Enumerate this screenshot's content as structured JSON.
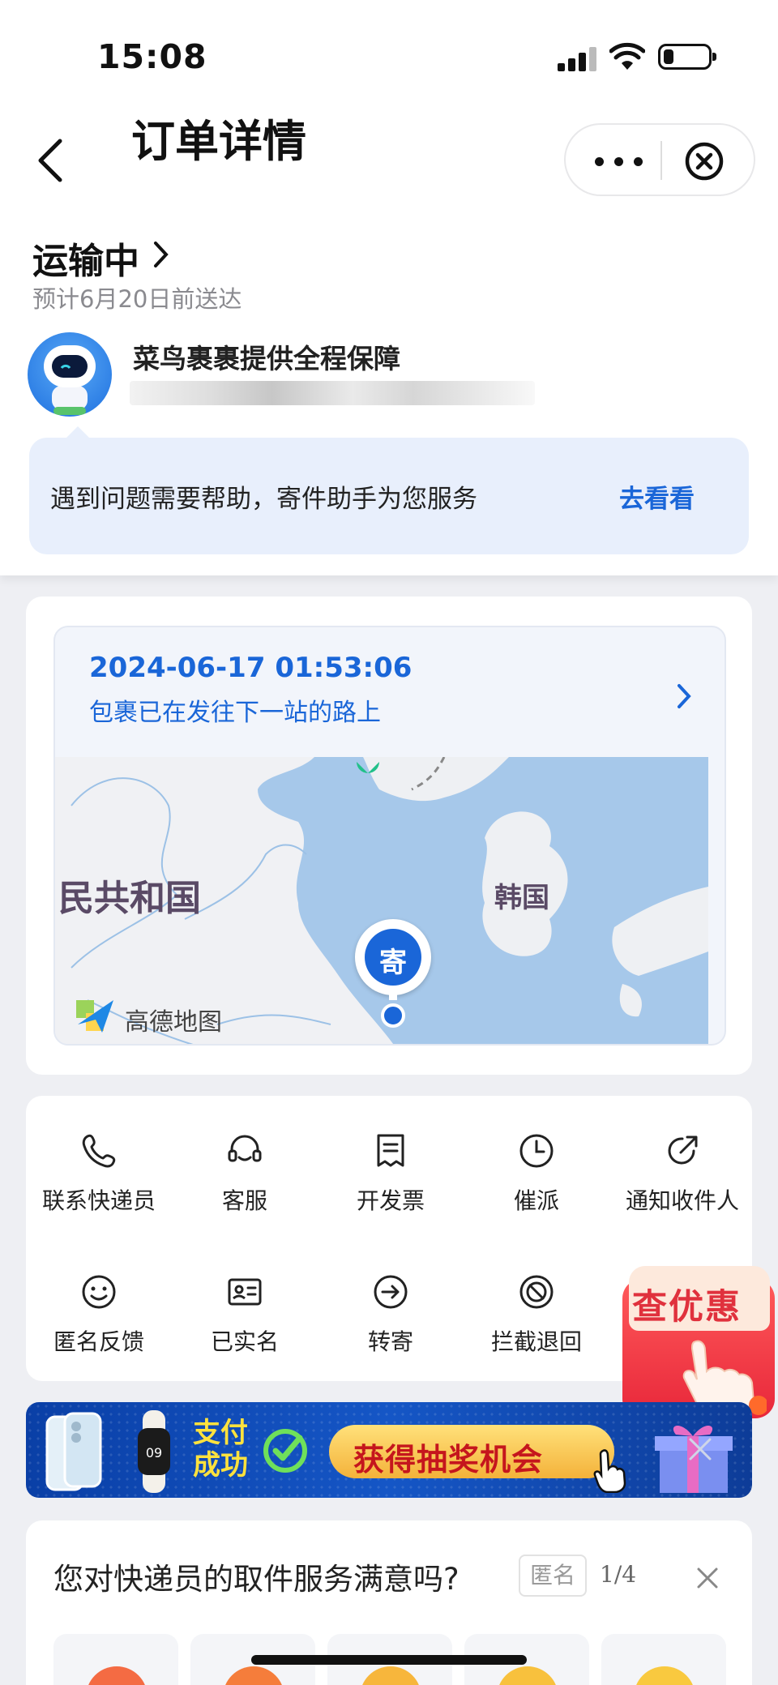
{
  "status_bar": {
    "time": "15:08"
  },
  "nav": {
    "title": "订单详情"
  },
  "order": {
    "status": "运输中",
    "eta": "预计6月20日前送达",
    "guarantee": "菜鸟裹裹提供全程保障",
    "help_text": "遇到问题需要帮助，寄件助手为您服务",
    "help_link": "去看看"
  },
  "tracking": {
    "datetime": "2024-06-17 01:53:06",
    "description": "包裹已在发往下一站的路上",
    "map": {
      "label_china": "民共和国",
      "label_korea": "韩国",
      "pin_label": "寄",
      "provider": "高德地图"
    }
  },
  "actions": [
    {
      "label": "联系快递员",
      "icon": "phone-icon"
    },
    {
      "label": "客服",
      "icon": "headset-icon"
    },
    {
      "label": "开发票",
      "icon": "invoice-icon"
    },
    {
      "label": "催派",
      "icon": "clock-icon"
    },
    {
      "label": "通知收件人",
      "icon": "share-icon"
    },
    {
      "label": "匿名反馈",
      "icon": "smile-icon"
    },
    {
      "label": "已实名",
      "icon": "id-card-icon"
    },
    {
      "label": "转寄",
      "icon": "forward-icon"
    },
    {
      "label": "拦截退回",
      "icon": "block-icon"
    }
  ],
  "coupon": {
    "label": "查优惠"
  },
  "banner": {
    "pay_success": "支付\n成功",
    "lottery": "获得抽奖机会"
  },
  "survey": {
    "question": "您对快递员的取件服务满意吗?",
    "anonymous": "匿名",
    "page": "1/4"
  },
  "colors": {
    "accent": "#1a66d8",
    "help_bg": "#e8effc",
    "page_bg": "#eeeff3"
  }
}
